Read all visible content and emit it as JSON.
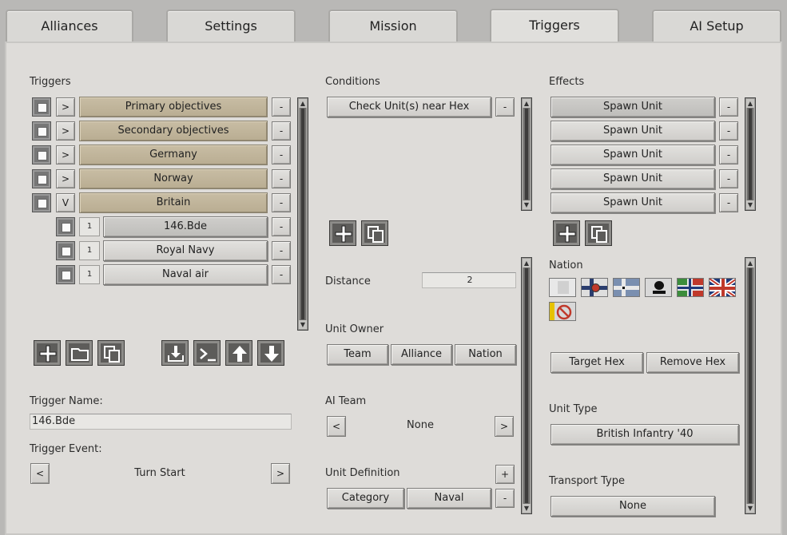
{
  "tabs": [
    {
      "label": "Alliances"
    },
    {
      "label": "Settings"
    },
    {
      "label": "Mission"
    },
    {
      "label": "Triggers",
      "active": true
    },
    {
      "label": "AI Setup"
    }
  ],
  "triggers": {
    "heading": "Triggers",
    "rows": [
      {
        "expander": ">",
        "label": "Primary objectives",
        "remove": "-"
      },
      {
        "expander": ">",
        "label": "Secondary objectives",
        "remove": "-"
      },
      {
        "expander": ">",
        "label": "Germany",
        "remove": "-"
      },
      {
        "expander": ">",
        "label": "Norway",
        "remove": "-"
      },
      {
        "expander": "V",
        "label": "Britain",
        "remove": "-"
      }
    ],
    "children": [
      {
        "num": "1",
        "label": "146.Bde",
        "remove": "-"
      },
      {
        "num": "1",
        "label": "Royal Navy",
        "remove": "-"
      },
      {
        "num": "1",
        "label": "Naval air",
        "remove": "-"
      }
    ],
    "toolbar_icons": [
      "add-icon",
      "folder-icon",
      "copy-icon",
      "import-icon",
      "console-icon",
      "move-up-icon",
      "move-down-icon"
    ],
    "name_label": "Trigger Name:",
    "name_value": "146.Bde",
    "event_label": "Trigger Event:",
    "event_value": "Turn Start",
    "event_prev": "<",
    "event_next": ">"
  },
  "conditions": {
    "heading": "Conditions",
    "items": [
      {
        "label": "Check Unit(s) near Hex",
        "remove": "-"
      }
    ],
    "toolbar_icons": [
      "add-icon",
      "copy-icon"
    ],
    "distance_label": "Distance",
    "distance_value": "2",
    "unit_owner_label": "Unit Owner",
    "owner_options": [
      "Team",
      "Alliance",
      "Nation"
    ],
    "ai_team_label": "AI Team",
    "ai_team_value": "None",
    "ai_prev": "<",
    "ai_next": ">",
    "unit_def_label": "Unit Definition",
    "unit_def_add": "+",
    "unit_def_remove": "-",
    "unit_def_category": "Category",
    "unit_def_value": "Naval"
  },
  "effects": {
    "heading": "Effects",
    "items": [
      {
        "label": "Spawn Unit",
        "remove": "-"
      },
      {
        "label": "Spawn Unit",
        "remove": "-"
      },
      {
        "label": "Spawn Unit",
        "remove": "-"
      },
      {
        "label": "Spawn Unit",
        "remove": "-"
      },
      {
        "label": "Spawn Unit",
        "remove": "-"
      }
    ],
    "toolbar_icons": [
      "add-icon",
      "copy-icon"
    ],
    "nation_label": "Nation",
    "flags": [
      "blank-flag",
      "finland-flag",
      "germany-flag",
      "ss-flag",
      "norway-flag",
      "britain-flag",
      "none-flag"
    ],
    "target_hex": "Target Hex",
    "remove_hex": "Remove Hex",
    "unit_type_label": "Unit Type",
    "unit_type_value": "British Infantry '40",
    "transport_label": "Transport Type",
    "transport_value": "None"
  }
}
